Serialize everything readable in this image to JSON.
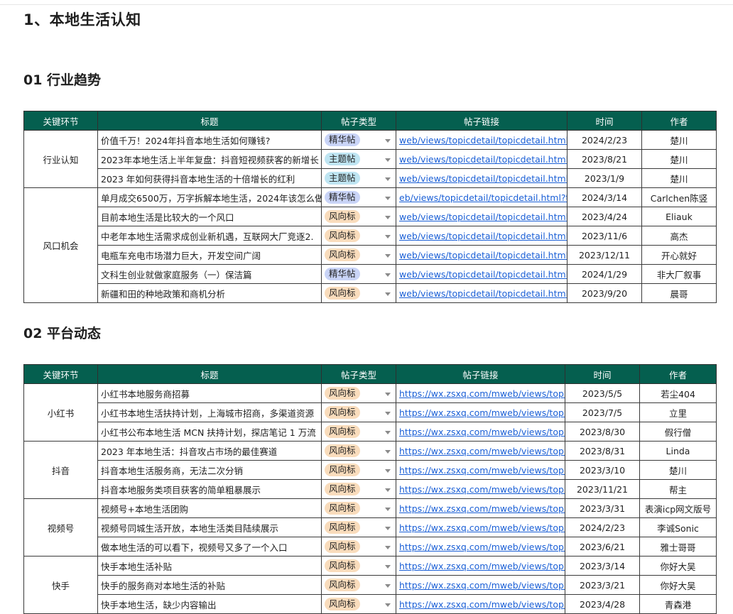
{
  "doc": {
    "title": "1、本地生活认知",
    "section1_title": "01 行业趋势",
    "section2_title": "02 平台动态"
  },
  "headers": [
    "关键环节",
    "标题",
    "帖子类型",
    "帖子链接",
    "时间",
    "作者"
  ],
  "table1": {
    "groups": [
      {
        "name": "行业认知",
        "rows": [
          {
            "title": "价值千万！2024年抖音本地生活如何赚钱?",
            "type": "精华帖",
            "link": "web/views/topicdetail/topicdetail.html?topi",
            "date": "2024/2/23",
            "author": "楚川"
          },
          {
            "title": "2023年本地生活上半年复盘：抖音短视频获客的新增长",
            "type": "主题帖",
            "link": "web/views/topicdetail/topicdetail.html?topi",
            "date": "2023/8/21",
            "author": "楚川"
          },
          {
            "title": "2023 年如何获得抖音本地生活的十倍增长的红利",
            "type": "主题帖",
            "link": "web/views/topicdetail/topicdetail.html?topi",
            "date": "2023/1/9",
            "author": "楚川"
          }
        ]
      },
      {
        "name": "风口机会",
        "rows": [
          {
            "title": "单月成交6500万，万字拆解本地生活，2024年该怎么做",
            "type": "精华帖",
            "link": "eb/views/topicdetail/topicdetail.html?topic",
            "date": "2024/3/14",
            "author": "Carlchen陈竖"
          },
          {
            "title": "目前本地生活是比较大的一个风口",
            "type": "风向标",
            "link": "web/views/topicdetail/topicdetail.html?topi",
            "date": "2023/4/24",
            "author": "Eliauk"
          },
          {
            "title": "中老年本地生活需求成创业新机遇，互联网大厂竞逐2.",
            "type": "风向标",
            "link": "web/views/topicdetail/topicdetail.html?topi",
            "date": "2023/11/6",
            "author": "高杰"
          },
          {
            "title": "电瓶车充电市场潜力巨大，开发空间广阔",
            "type": "风向标",
            "link": "web/views/topicdetail/topicdetail.html?topi",
            "date": "2023/12/11",
            "author": "开心就好"
          },
          {
            "title": "文科生创业就做家庭服务（一）保洁篇",
            "type": "精华帖",
            "link": "web/views/topicdetail/topicdetail.html?topi",
            "date": "2024/1/29",
            "author": "非大厂叙事"
          },
          {
            "title": "新疆和田的种地政策和商机分析",
            "type": "风向标",
            "link": "web/views/topicdetail/topicdetail.html?topi",
            "date": "2023/9/20",
            "author": "晨哥"
          }
        ]
      }
    ]
  },
  "table2": {
    "groups": [
      {
        "name": "小红书",
        "rows": [
          {
            "title": "小红书本地服务商招募",
            "type": "风向标",
            "link": "https://wx.zsxq.com/mweb/views/topicd",
            "date": "2023/5/5",
            "author": "若尘404"
          },
          {
            "title": "小红书本地生活扶持计划，上海城市招商，多渠道资源",
            "type": "风向标",
            "link": "https://wx.zsxq.com/mweb/views/topicd",
            "date": "2023/7/5",
            "author": "立里"
          },
          {
            "title": "小红书公布本地生活 MCN 扶持计划，探店笔记 1 万流",
            "type": "风向标",
            "link": "https://wx.zsxq.com/mweb/views/topicd",
            "date": "2023/8/30",
            "author": "假行僧"
          }
        ]
      },
      {
        "name": "抖音",
        "rows": [
          {
            "title": "2023 年本地生活：抖音攻占市场的最佳赛道",
            "type": "风向标",
            "link": "https://wx.zsxq.com/mweb/views/topicd",
            "date": "2023/8/31",
            "author": "Linda"
          },
          {
            "title": "抖音本地生活服务商，无法二次分销",
            "type": "风向标",
            "link": "https://wx.zsxq.com/mweb/views/topicd",
            "date": "2023/3/10",
            "author": "楚川"
          },
          {
            "title": "抖音本地服务类项目获客的简单粗暴展示",
            "type": "风向标",
            "link": "https://wx.zsxq.com/mweb/views/topicd",
            "date": "2023/11/21",
            "author": "帮主"
          }
        ]
      },
      {
        "name": "视频号",
        "rows": [
          {
            "title": "视频号+本地生活团购",
            "type": "风向标",
            "link": "https://wx.zsxq.com/mweb/views/topicd",
            "date": "2023/3/31",
            "author": "表演icp网文版号"
          },
          {
            "title": "视频号同城生活开放，本地生活类目陆续展示",
            "type": "风向标",
            "link": "https://wx.zsxq.com/mweb/views/topicd",
            "date": "2024/2/23",
            "author": "李诚Sonic"
          },
          {
            "title": "做本地生活的可以看下，视频号又多了一个入口",
            "type": "风向标",
            "link": "https://wx.zsxq.com/mweb/views/topicd",
            "date": "2023/6/21",
            "author": "雅士哥哥"
          }
        ]
      },
      {
        "name": "快手",
        "rows": [
          {
            "title": "快手本地生活补贴",
            "type": "风向标",
            "link": "https://wx.zsxq.com/mweb/views/topicd",
            "date": "2023/3/14",
            "author": "你好大吴"
          },
          {
            "title": "快手的服务商对本地生活的补贴",
            "type": "风向标",
            "link": "https://wx.zsxq.com/mweb/views/topicd",
            "date": "2023/3/21",
            "author": "你好大吴"
          },
          {
            "title": "快手本地生活，缺少内容输出",
            "type": "风向标",
            "link": "https://wx.zsxq.com/mweb/views/topicd",
            "date": "2023/4/28",
            "author": "青森港"
          }
        ]
      }
    ]
  },
  "colors": {
    "header_bg": "#055f4f",
    "link": "#1a5fd6",
    "tag_essence": "#c9d4f7",
    "tag_topic": "#bfe5f2",
    "tag_wind": "#f9dcbc"
  }
}
